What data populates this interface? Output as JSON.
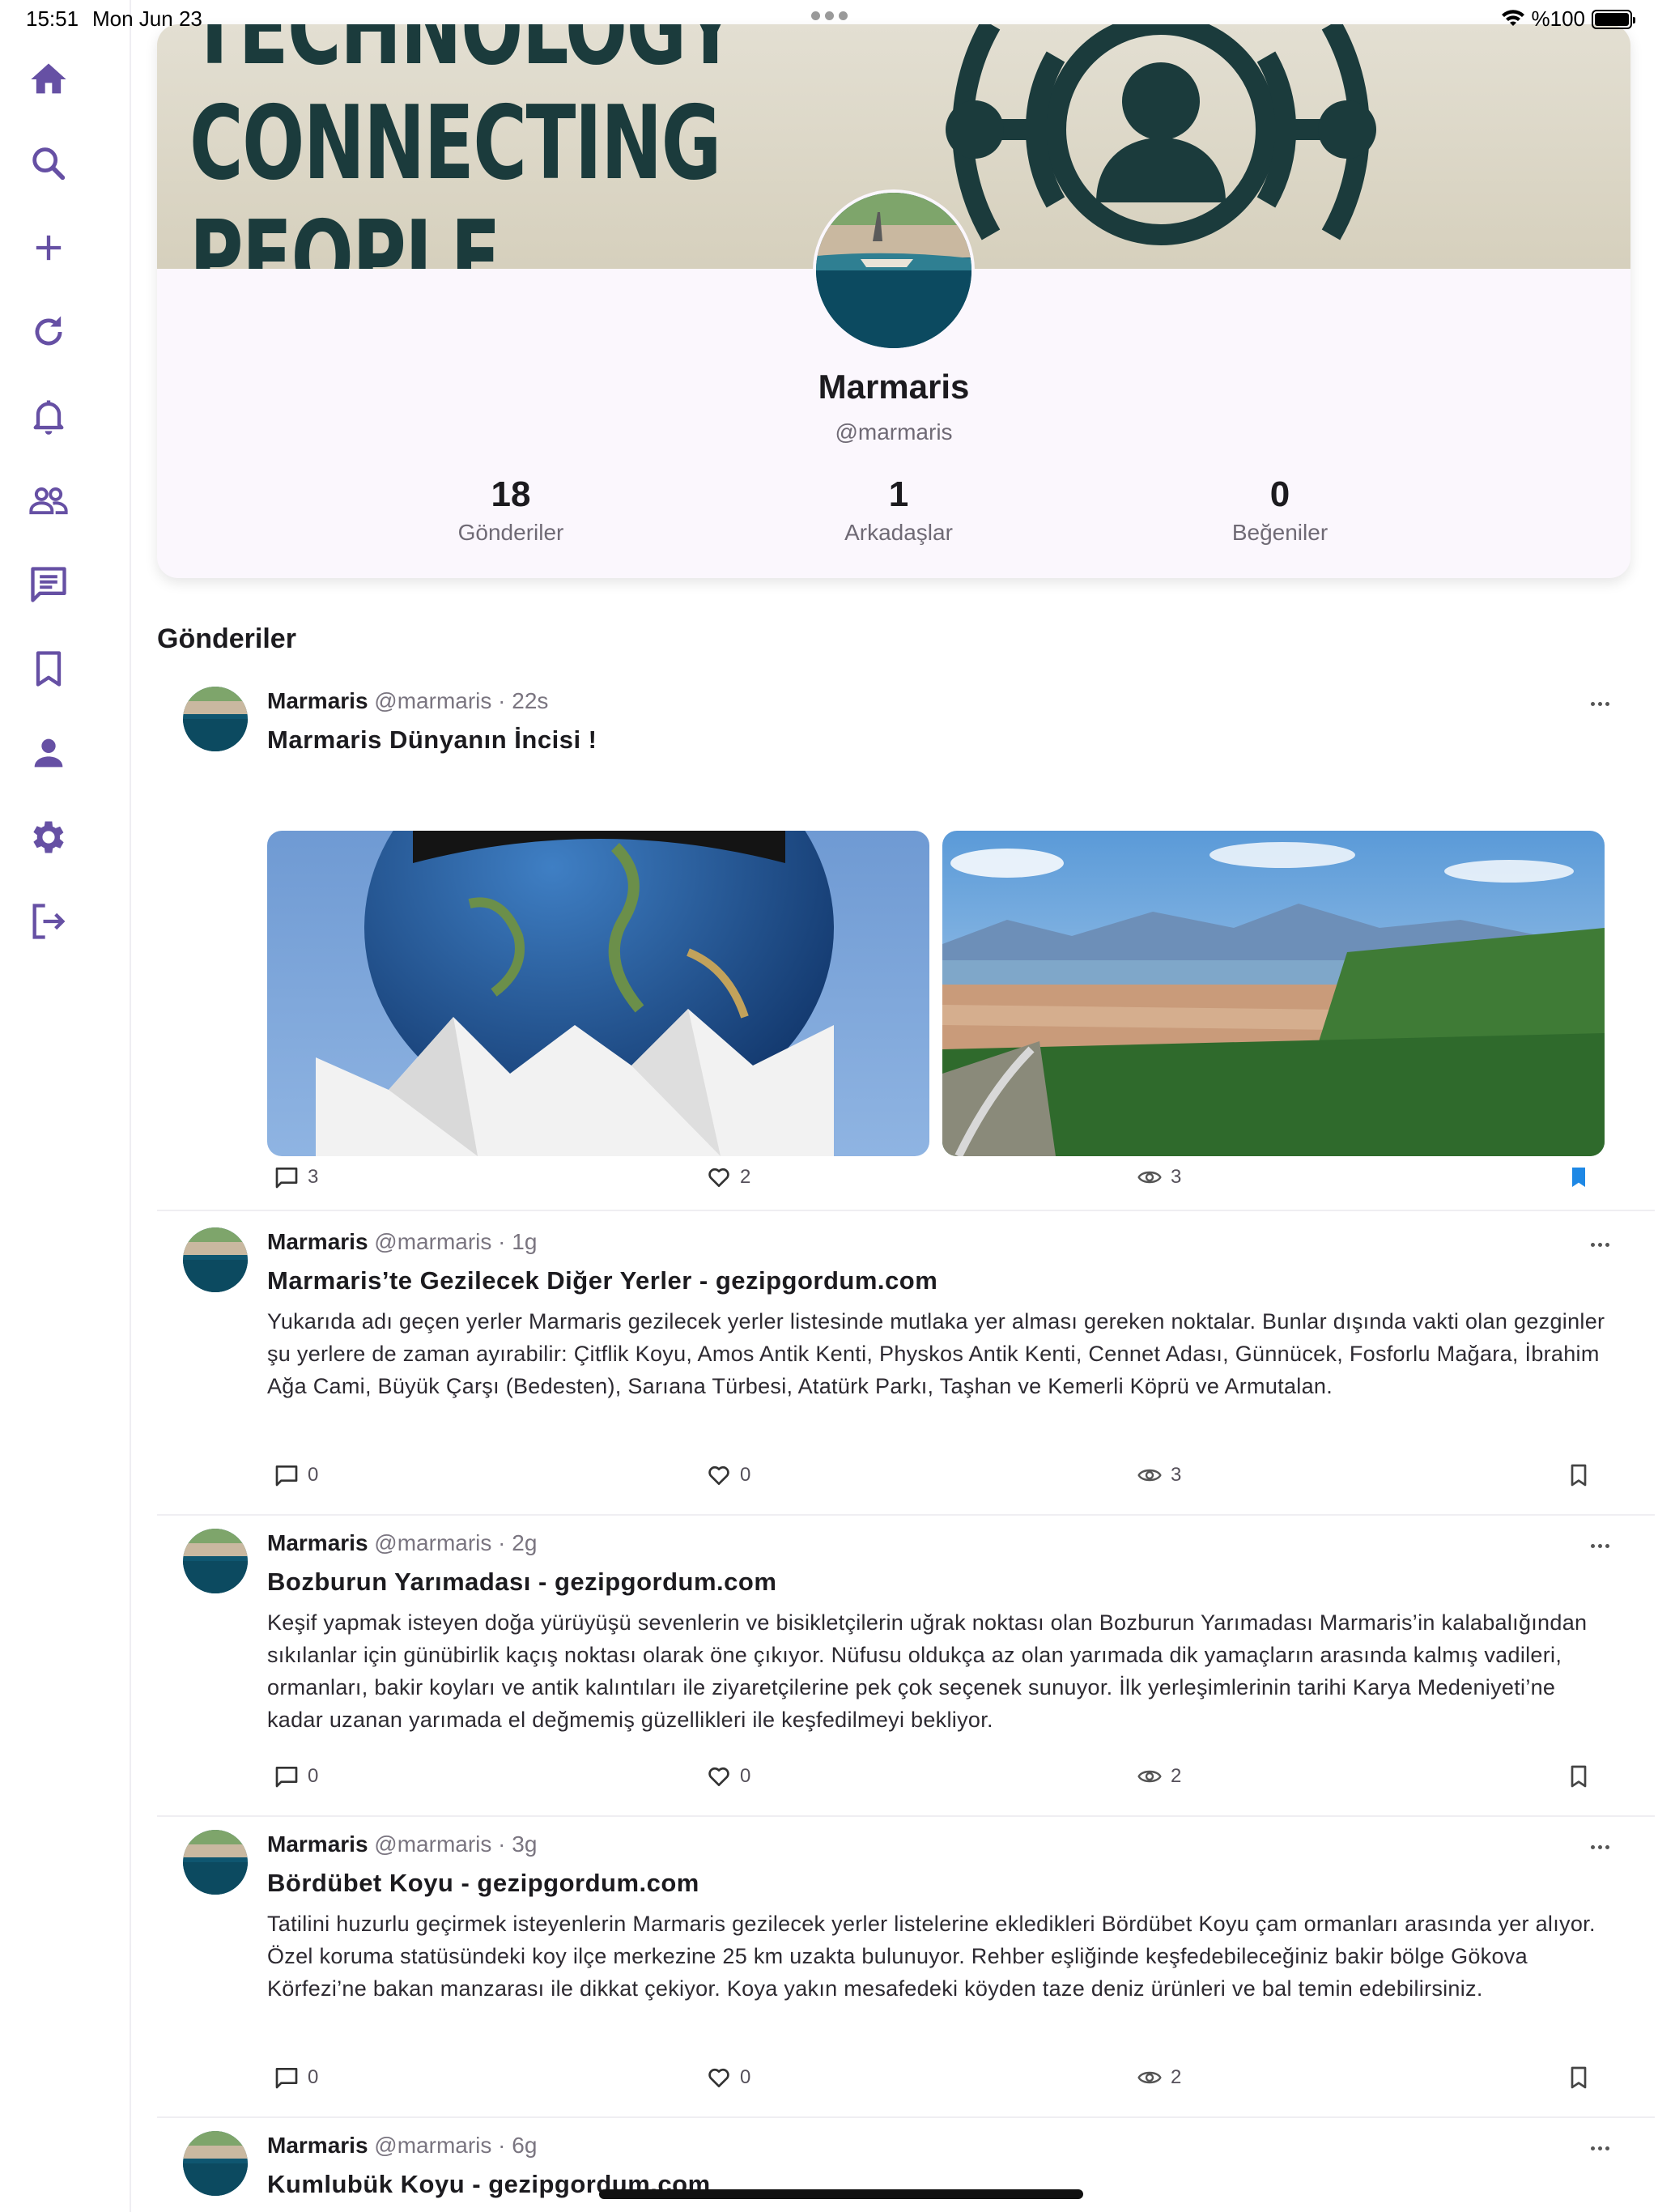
{
  "status_bar": {
    "time": "15:51",
    "date": "Mon Jun 23",
    "battery": "%100",
    "battery_level": 1.0
  },
  "sidebar": {
    "items": [
      {
        "name": "home",
        "icon": "home-icon"
      },
      {
        "name": "search",
        "icon": "search-icon"
      },
      {
        "name": "create",
        "icon": "plus-icon"
      },
      {
        "name": "refresh",
        "icon": "refresh-icon"
      },
      {
        "name": "notifications",
        "icon": "bell-icon"
      },
      {
        "name": "friends",
        "icon": "people-icon"
      },
      {
        "name": "messages",
        "icon": "message-icon"
      },
      {
        "name": "bookmarks",
        "icon": "bookmark-icon"
      },
      {
        "name": "profile",
        "icon": "person-icon"
      },
      {
        "name": "settings",
        "icon": "gear-icon"
      },
      {
        "name": "logout",
        "icon": "logout-icon"
      }
    ],
    "accent": "#6650a4"
  },
  "profile": {
    "banner_lines": [
      "TECHNOLOGY",
      "CONNECTING",
      "PEOPLE"
    ],
    "name": "Marmaris",
    "handle": "@marmaris",
    "stats": [
      {
        "value": "18",
        "label": "Gönderiler"
      },
      {
        "value": "1",
        "label": "Arkadaşlar"
      },
      {
        "value": "0",
        "label": "Beğeniler"
      }
    ]
  },
  "section_title": "Gönderiler",
  "posts": [
    {
      "author": "Marmaris",
      "meta": "@marmaris · 22s",
      "title": "Marmaris Dünyanın İncisi !",
      "body": "",
      "comments": "3",
      "likes": "2",
      "views": "3",
      "bookmarked": true
    },
    {
      "author": "Marmaris",
      "meta": "@marmaris · 1g",
      "title": "Marmaris’te Gezilecek Diğer Yerler - gezipgordum.com",
      "body": "Yukarıda adı geçen yerler Marmaris gezilecek yerler listesinde mutlaka yer alması gereken noktalar. Bunlar dışında vakti olan gezginler şu yerlere de zaman ayırabilir: Çitflik Koyu, Amos Antik Kenti, Physkos Antik Kenti, Cennet Adası, Günnücek, Fosforlu Mağara, İbrahim Ağa Cami, Büyük Çarşı (Bedesten), Sarıana Türbesi, Atatürk Parkı, Taşhan ve Kemerli Köprü ve Armutalan.",
      "comments": "0",
      "likes": "0",
      "views": "3",
      "bookmarked": false
    },
    {
      "author": "Marmaris",
      "meta": "@marmaris · 2g",
      "title": "Bozburun Yarımadası - gezipgordum.com",
      "body": "Keşif yapmak isteyen doğa yürüyüşü sevenlerin ve bisikletçilerin uğrak noktası olan Bozburun Yarımadası Marmaris’in kalabalığından sıkılanlar için günübirlik kaçış noktası olarak öne çıkıyor. Nüfusu oldukça az olan yarımada dik yamaçların arasında kalmış vadileri, ormanları, bakir koyları ve antik kalıntıları ile ziyaretçilerine pek çok seçenek sunuyor. İlk yerleşimlerinin tarihi Karya Medeniyeti’ne kadar uzanan yarımada el değmemiş güzellikleri ile keşfedilmeyi bekliyor.",
      "comments": "0",
      "likes": "0",
      "views": "2",
      "bookmarked": false
    },
    {
      "author": "Marmaris",
      "meta": "@marmaris · 3g",
      "title": "Bördübet Koyu - gezipgordum.com",
      "body": "Tatilini huzurlu geçirmek isteyenlerin Marmaris gezilecek yerler listelerine ekledikleri Bördübet Koyu çam ormanları arasında yer alıyor. Özel koruma statüsündeki koy ilçe merkezine 25 km uzakta bulunuyor. Rehber eşliğinde keşfedebileceğiniz bakir bölge Gökova Körfezi’ne bakan manzarası ile dikkat çekiyor. Koya yakın mesafedeki köyden taze deniz ürünleri ve bal temin edebilirsiniz.",
      "comments": "0",
      "likes": "0",
      "views": "2",
      "bookmarked": false
    },
    {
      "author": "Marmaris",
      "meta": "@marmaris · 6g",
      "title": "Kumlubük Koyu - gezipgordum.com",
      "body": ""
    }
  ]
}
